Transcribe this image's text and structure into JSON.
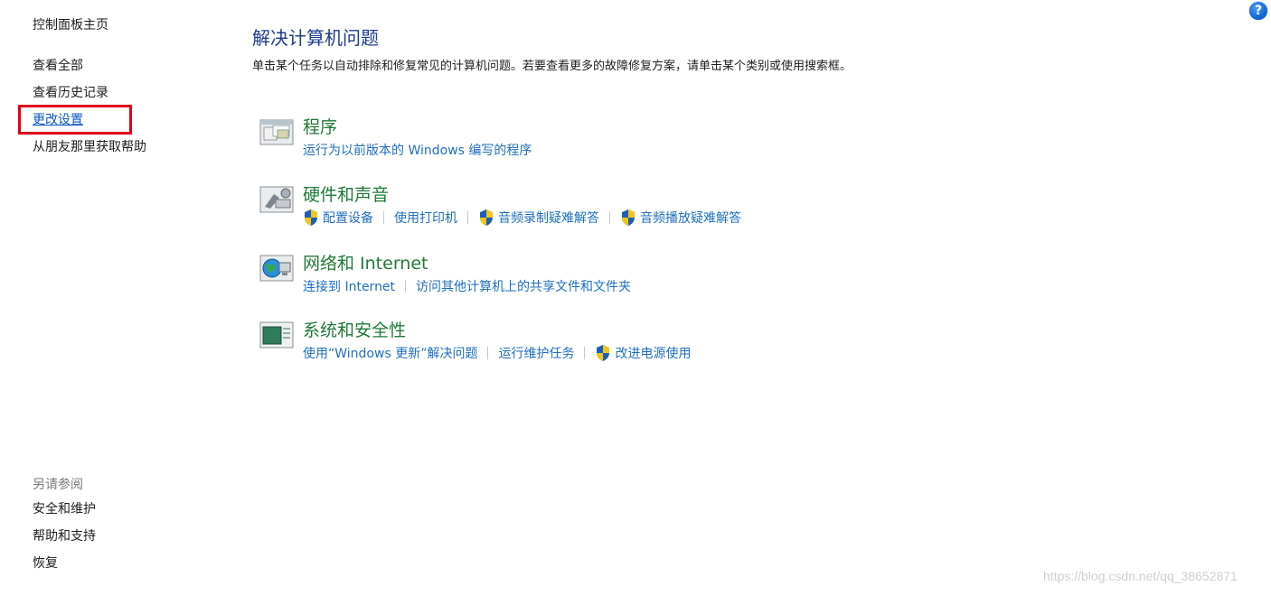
{
  "sidebar": {
    "items": [
      {
        "label": "控制面板主页"
      },
      {
        "label": "查看全部"
      },
      {
        "label": "查看历史记录"
      },
      {
        "label": "更改设置"
      },
      {
        "label": "从朋友那里获取帮助"
      }
    ],
    "see_also_label": "另请参阅",
    "see_also_items": [
      {
        "label": "安全和维护"
      },
      {
        "label": "帮助和支持"
      },
      {
        "label": "恢复"
      }
    ],
    "highlight_color": "#e2001a"
  },
  "help": {
    "label": "?"
  },
  "main": {
    "title": "解决计算机问题",
    "description": "单击某个任务以自动排除和修复常见的计算机问题。若要查看更多的故障修复方案，请单击某个类别或使用搜索框。",
    "categories": [
      {
        "title": "程序",
        "icon": "programs-icon",
        "links": [
          {
            "label": "运行为以前版本的 Windows 编写的程序"
          }
        ]
      },
      {
        "title": "硬件和声音",
        "icon": "hardware-sound-icon",
        "links": [
          {
            "label": "配置设备"
          },
          {
            "label": "使用打印机"
          },
          {
            "label": "音频录制疑难解答"
          },
          {
            "label": "音频播放疑难解答"
          }
        ]
      },
      {
        "title": "网络和 Internet",
        "icon": "network-icon",
        "links": [
          {
            "label": "连接到 Internet"
          },
          {
            "label": "访问其他计算机上的共享文件和文件夹"
          }
        ]
      },
      {
        "title": "系统和安全性",
        "icon": "system-security-icon",
        "links": [
          {
            "label": "使用“Windows 更新”解决问题"
          },
          {
            "label": "运行维护任务"
          },
          {
            "label": "改进电源使用"
          }
        ]
      }
    ]
  },
  "watermark": "https://blog.csdn.net/qq_38652871",
  "colors": {
    "title_blue": "#1e3c8c",
    "category_green": "#1f7a3a",
    "link_blue": "#1f6fbf"
  }
}
